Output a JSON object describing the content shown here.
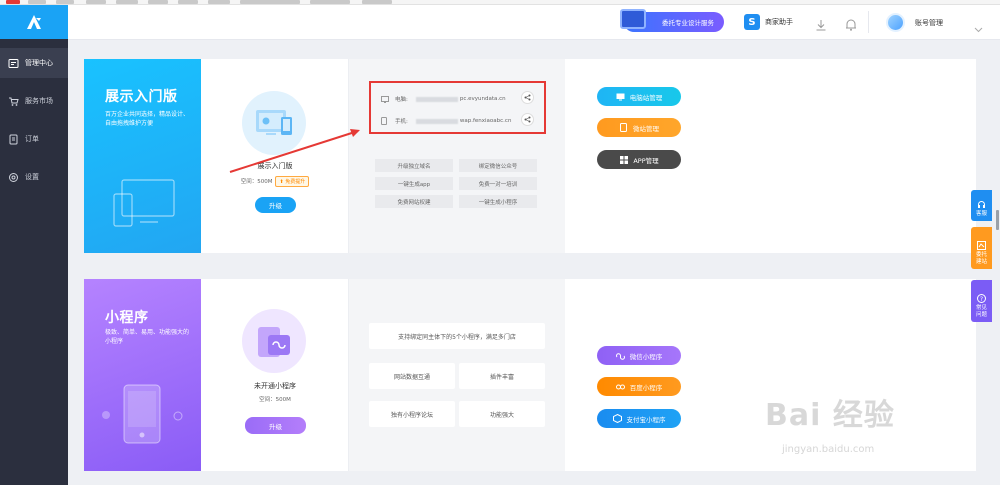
{
  "sidebar": {
    "items": [
      {
        "label": "管理中心",
        "icon": "dashboard-icon"
      },
      {
        "label": "服务市场",
        "icon": "cart-icon"
      },
      {
        "label": "订单",
        "icon": "order-icon"
      },
      {
        "label": "设置",
        "icon": "settings-icon"
      }
    ]
  },
  "header": {
    "design_service": "委托专业设计服务",
    "helper": "商家助手",
    "helper_badge": "S",
    "account": "账号管理"
  },
  "card1": {
    "title": "展示入门版",
    "desc": "百万企业共同选择，精品设计、自由拖拽维护方便",
    "product_name": "展示入门版",
    "space": "空间：500M",
    "free_badge": "免费提升",
    "upgrade": "升级",
    "pc_label": "电脑:",
    "pc_url": "pc.evyundata.cn",
    "mobile_label": "手机:",
    "mobile_url": "wap.fenxiaoabc.cn",
    "tags": [
      "升级独立域名",
      "绑定微信公众号",
      "一键生成app",
      "免费一对一培训",
      "免费网站权建",
      "一键生成小程序"
    ],
    "actions": [
      "电脑站管理",
      "微站管理",
      "APP管理"
    ]
  },
  "card2": {
    "title": "小程序",
    "desc": "极致、简单、易用、功能强大的小程序",
    "product_name": "未开通小程序",
    "space": "空间：500M",
    "upgrade": "升级",
    "feature_top": "支持绑定同主体下的5个小程序，满足多门店",
    "features": [
      "网站数据互通",
      "插件丰富",
      "独有小程序论坛",
      "功能强大"
    ],
    "actions": [
      "微信小程序",
      "百度小程序",
      "支付宝小程序"
    ]
  },
  "float_tabs": [
    {
      "label": "客服",
      "color": "#1f8ef1"
    },
    {
      "label": "委托建站",
      "color": "#ff9a1f"
    },
    {
      "label": "常见问题",
      "color": "#7b5cf5"
    }
  ],
  "watermark": {
    "main": "Bai 经验",
    "sub": "jingyan.baidu.com"
  }
}
